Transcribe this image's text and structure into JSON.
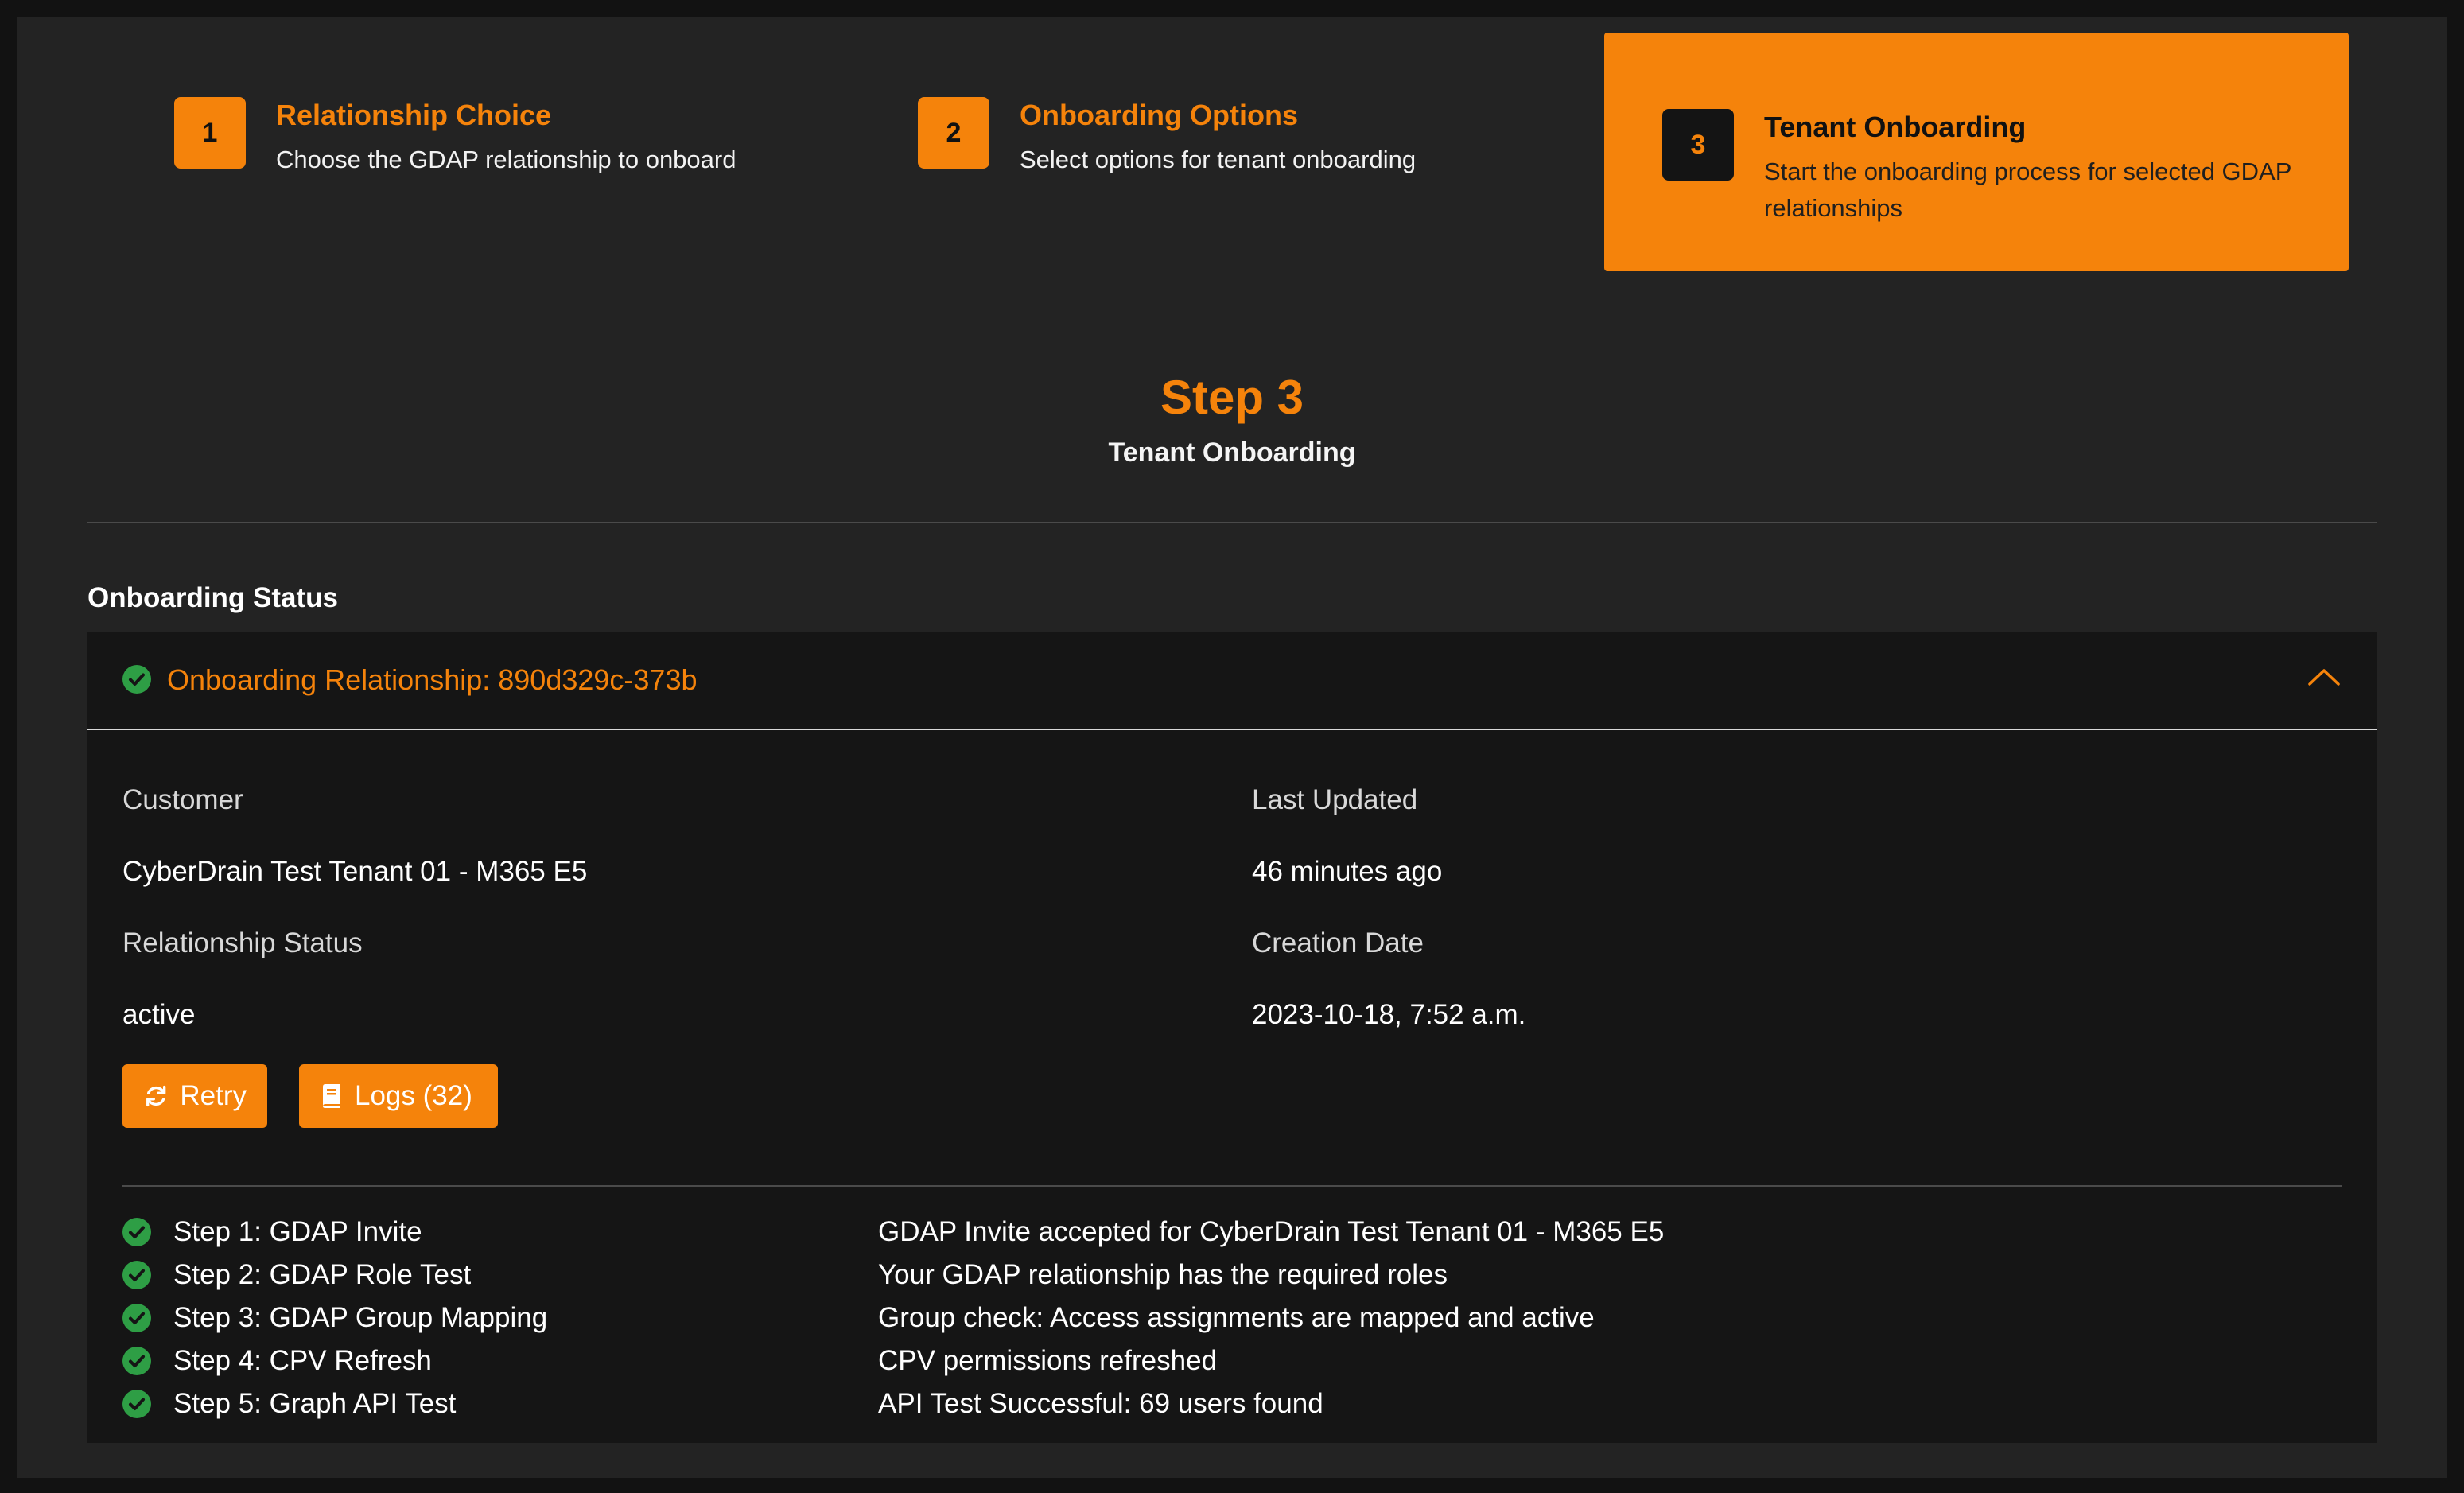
{
  "stepper": {
    "steps": [
      {
        "number": "1",
        "title": "Relationship Choice",
        "description": "Choose the GDAP relationship to onboard"
      },
      {
        "number": "2",
        "title": "Onboarding Options",
        "description": "Select options for tenant onboarding"
      },
      {
        "number": "3",
        "title": "Tenant Onboarding",
        "description": "Start the onboarding process for selected GDAP relationships"
      }
    ],
    "active_step": 3
  },
  "heading": {
    "title": "Step 3",
    "subtitle": "Tenant Onboarding"
  },
  "section": {
    "title": "Onboarding Status"
  },
  "relationship": {
    "title": "Onboarding Relationship: 890d329c-373b",
    "expanded": true,
    "status_icon": "check-circle-icon",
    "fields": {
      "customer_label": "Customer",
      "customer_value": "CyberDrain Test Tenant 01 - M365 E5",
      "relationship_status_label": "Relationship Status",
      "relationship_status_value": "active",
      "last_updated_label": "Last Updated",
      "last_updated_value": "46 minutes ago",
      "creation_date_label": "Creation Date",
      "creation_date_value": "2023-10-18, 7:52 a.m."
    },
    "buttons": {
      "retry_label": "Retry",
      "logs_label": "Logs (32)"
    },
    "steps": [
      {
        "name": "Step 1: GDAP Invite",
        "message": "GDAP Invite accepted for CyberDrain Test Tenant 01 - M365 E5",
        "status": "success"
      },
      {
        "name": "Step 2: GDAP Role Test",
        "message": "Your GDAP relationship has the required roles",
        "status": "success"
      },
      {
        "name": "Step 3: GDAP Group Mapping",
        "message": "Group check: Access assignments are mapped and active",
        "status": "success"
      },
      {
        "name": "Step 4: CPV Refresh",
        "message": "CPV permissions refreshed",
        "status": "success"
      },
      {
        "name": "Step 5: Graph API Test",
        "message": "API Test Successful: 69 users found",
        "status": "success"
      }
    ]
  },
  "colors": {
    "accent": "#f5830b",
    "success": "#2e9e45",
    "background": "#232323",
    "panel": "#151515"
  }
}
